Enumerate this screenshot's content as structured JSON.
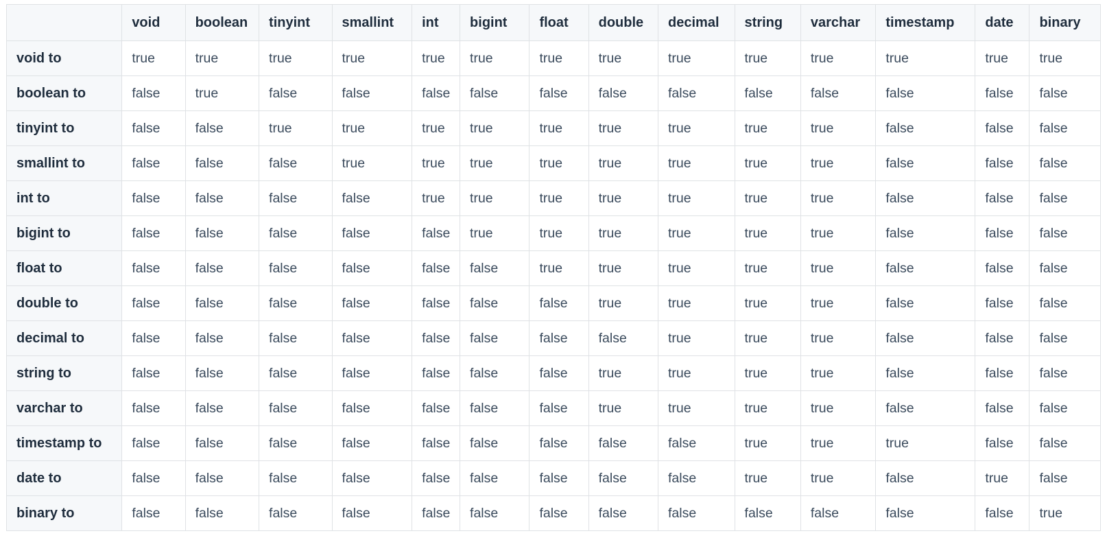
{
  "table": {
    "corner_label": "",
    "columns": [
      "void",
      "boolean",
      "tinyint",
      "smallint",
      "int",
      "bigint",
      "float",
      "double",
      "decimal",
      "string",
      "varchar",
      "timestamp",
      "date",
      "binary"
    ],
    "rows": [
      {
        "header": "void to",
        "cells": [
          "true",
          "true",
          "true",
          "true",
          "true",
          "true",
          "true",
          "true",
          "true",
          "true",
          "true",
          "true",
          "true",
          "true"
        ]
      },
      {
        "header": "boolean to",
        "cells": [
          "false",
          "true",
          "false",
          "false",
          "false",
          "false",
          "false",
          "false",
          "false",
          "false",
          "false",
          "false",
          "false",
          "false"
        ]
      },
      {
        "header": "tinyint to",
        "cells": [
          "false",
          "false",
          "true",
          "true",
          "true",
          "true",
          "true",
          "true",
          "true",
          "true",
          "true",
          "false",
          "false",
          "false"
        ]
      },
      {
        "header": "smallint to",
        "cells": [
          "false",
          "false",
          "false",
          "true",
          "true",
          "true",
          "true",
          "true",
          "true",
          "true",
          "true",
          "false",
          "false",
          "false"
        ]
      },
      {
        "header": "int to",
        "cells": [
          "false",
          "false",
          "false",
          "false",
          "true",
          "true",
          "true",
          "true",
          "true",
          "true",
          "true",
          "false",
          "false",
          "false"
        ]
      },
      {
        "header": "bigint to",
        "cells": [
          "false",
          "false",
          "false",
          "false",
          "false",
          "true",
          "true",
          "true",
          "true",
          "true",
          "true",
          "false",
          "false",
          "false"
        ]
      },
      {
        "header": "float to",
        "cells": [
          "false",
          "false",
          "false",
          "false",
          "false",
          "false",
          "true",
          "true",
          "true",
          "true",
          "true",
          "false",
          "false",
          "false"
        ]
      },
      {
        "header": "double to",
        "cells": [
          "false",
          "false",
          "false",
          "false",
          "false",
          "false",
          "false",
          "true",
          "true",
          "true",
          "true",
          "false",
          "false",
          "false"
        ]
      },
      {
        "header": "decimal to",
        "cells": [
          "false",
          "false",
          "false",
          "false",
          "false",
          "false",
          "false",
          "false",
          "true",
          "true",
          "true",
          "false",
          "false",
          "false"
        ]
      },
      {
        "header": "string to",
        "cells": [
          "false",
          "false",
          "false",
          "false",
          "false",
          "false",
          "false",
          "true",
          "true",
          "true",
          "true",
          "false",
          "false",
          "false"
        ]
      },
      {
        "header": "varchar to",
        "cells": [
          "false",
          "false",
          "false",
          "false",
          "false",
          "false",
          "false",
          "true",
          "true",
          "true",
          "true",
          "false",
          "false",
          "false"
        ]
      },
      {
        "header": "timestamp to",
        "cells": [
          "false",
          "false",
          "false",
          "false",
          "false",
          "false",
          "false",
          "false",
          "false",
          "true",
          "true",
          "true",
          "false",
          "false"
        ]
      },
      {
        "header": "date to",
        "cells": [
          "false",
          "false",
          "false",
          "false",
          "false",
          "false",
          "false",
          "false",
          "false",
          "true",
          "true",
          "false",
          "true",
          "false"
        ]
      },
      {
        "header": "binary to",
        "cells": [
          "false",
          "false",
          "false",
          "false",
          "false",
          "false",
          "false",
          "false",
          "false",
          "false",
          "false",
          "false",
          "false",
          "true"
        ]
      }
    ]
  },
  "colors": {
    "header_background": "#f6f8fa",
    "body_background": "#ffffff",
    "border": "#dfe2e5",
    "header_text": "#1f2d3d",
    "body_text": "#3a4a5c"
  }
}
